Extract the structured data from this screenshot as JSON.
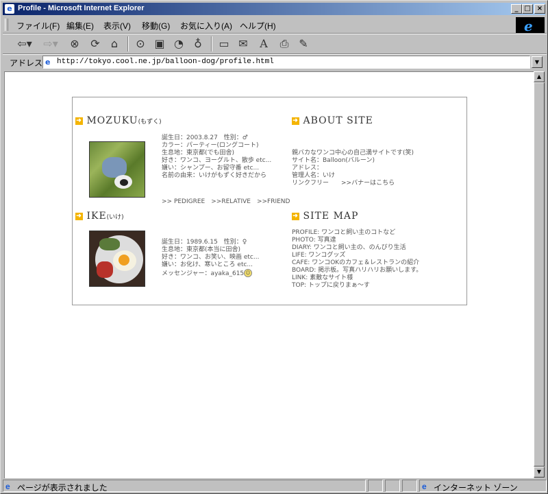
{
  "window": {
    "title": "Profile - Microsoft Internet Explorer"
  },
  "menu": [
    "ファイル(F)",
    "編集(E)",
    "表示(V)",
    "移動(G)",
    "お気に入り(A)",
    "ヘルプ(H)"
  ],
  "address": {
    "label": "アドレス",
    "url": "http://tokyo.cool.ne.jp/balloon-dog/profile.html"
  },
  "mozuku": {
    "name": "MOZUKU",
    "kana": "(もずく)",
    "lines": [
      "誕生日：2003.8.27　性別：♂",
      "カラー：パーティー(ロングコート)",
      "生息地：東京都(でも田舎)",
      "好き：ワンコ、ヨーグルト、散歩 etc...",
      "嫌い：シャンプー、お留守番 etc...",
      "名前の由来：いけがもずく好きだから"
    ],
    "links": ">> PEDIGREE　>>RELATIVE　>>FRIEND"
  },
  "ike": {
    "name": "IKE",
    "kana": "(いけ)",
    "lines": [
      "誕生日：1989.6.15　性別：♀",
      "生息地：東京都(本当に田舎)",
      "好き：ワンコ、お笑い、映画 etc...",
      "嫌い：お化け、寒いところ etc..."
    ],
    "messenger": "メッセンジャー：ayaka_615"
  },
  "about": {
    "title": "ABOUT SITE",
    "lines": [
      "親バカなワンコ中心の自己満サイトです(笑)",
      "サイト名：Balloon(バルーン)",
      "アドレス：",
      "管理人名：いけ"
    ],
    "link_free": "リンクフリー　　>>バナーはこちら"
  },
  "sitemap": {
    "title": "SITE MAP",
    "lines": [
      "PROFILE: ワンコと飼い主のコトなど",
      "PHOTO: 写真達",
      "DIARY: ワンコと飼い主の、のんびり生活",
      "LIFE: ワンコグッズ",
      "CAFE: ワンコOKのカフェ＆レストランの紹介",
      "BOARD: 掲示板。写真ハリハリお願いします。",
      "LINK: 素敵なサイト様",
      "TOP: トップに戻りまぁ～す"
    ]
  },
  "status": {
    "left": "ページが表示されました",
    "zone": "インターネット ゾーン"
  }
}
